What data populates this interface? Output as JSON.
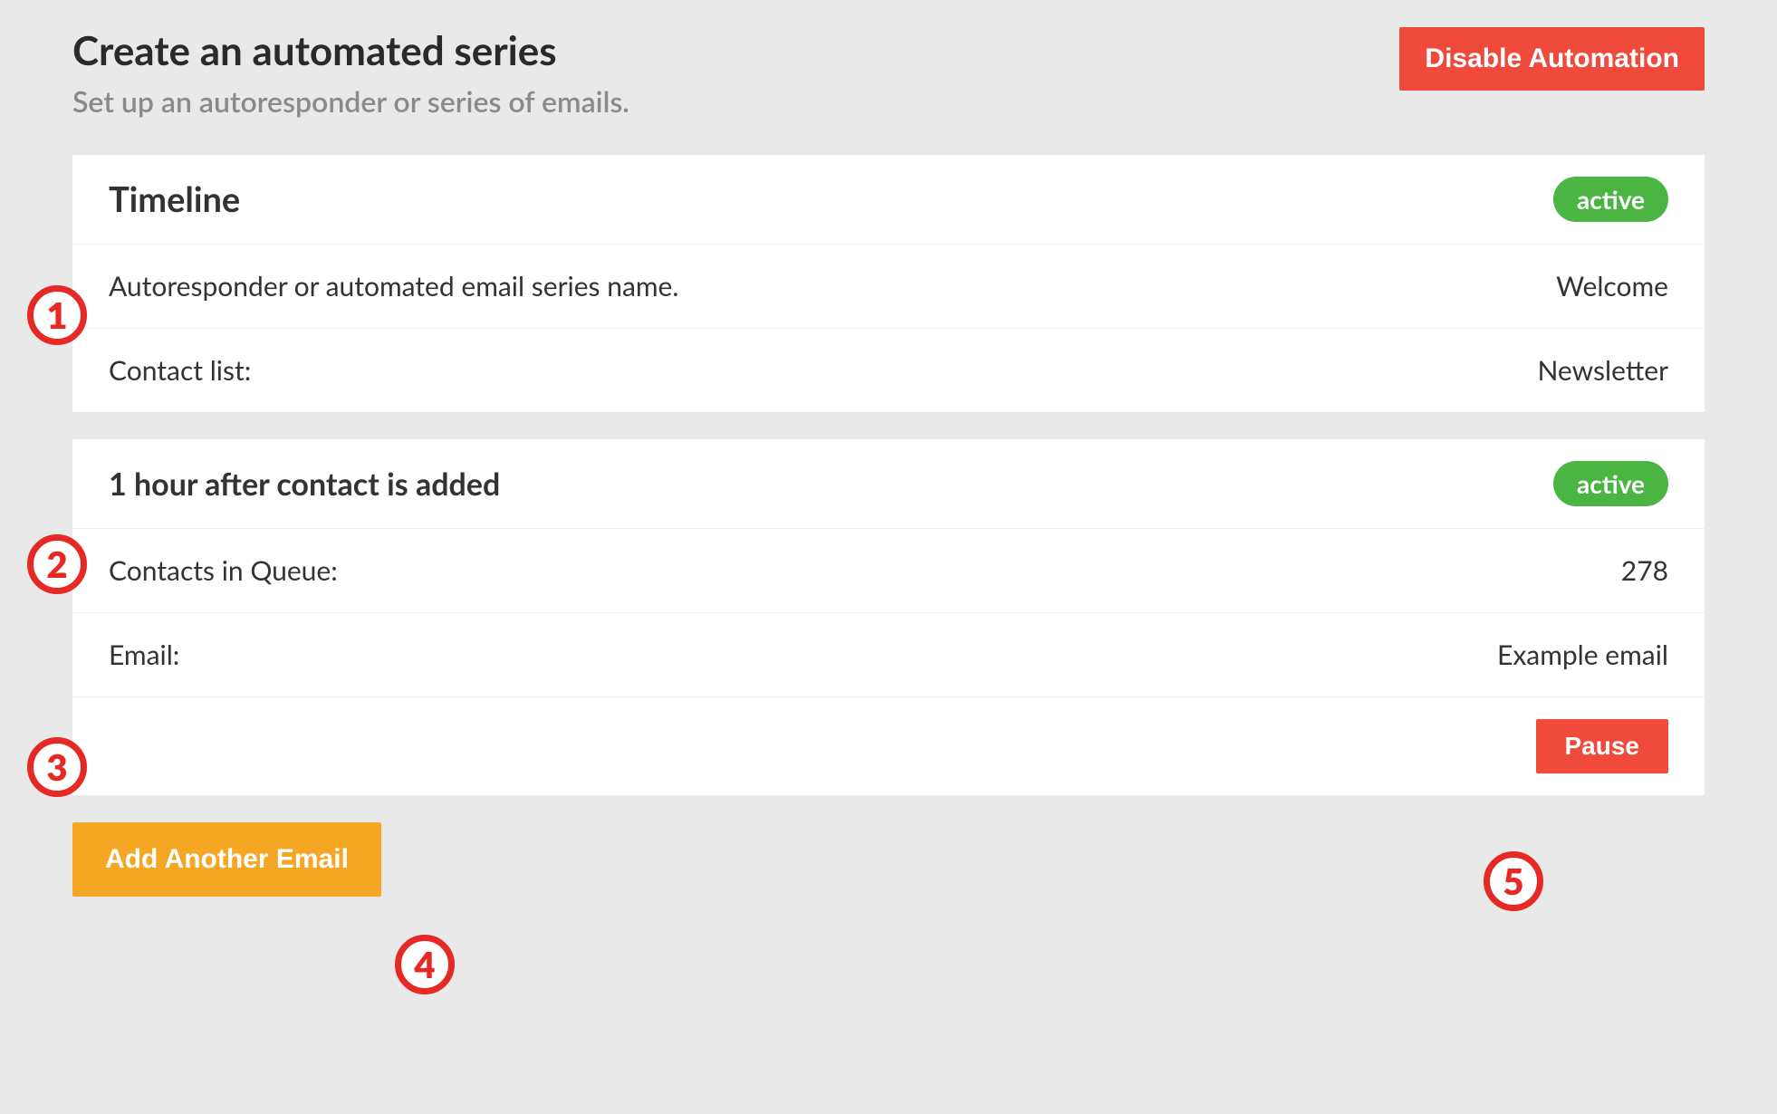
{
  "header": {
    "title": "Create an automated series",
    "subtitle": "Set up an autoresponder or series of emails.",
    "disable_button": "Disable Automation"
  },
  "timeline": {
    "title": "Timeline",
    "status": "active",
    "rows": [
      {
        "label": "Autoresponder or automated email series name.",
        "value": "Welcome"
      },
      {
        "label": "Contact list:",
        "value": "Newsletter"
      }
    ]
  },
  "step": {
    "title": "1 hour after contact is added",
    "status": "active",
    "rows": [
      {
        "label": "Contacts in Queue:",
        "value": "278"
      },
      {
        "label": "Email:",
        "value": "Example email"
      }
    ],
    "pause_button": "Pause"
  },
  "add_button": "Add Another Email",
  "callouts": {
    "1": "1",
    "2": "2",
    "3": "3",
    "4": "4",
    "5": "5"
  }
}
